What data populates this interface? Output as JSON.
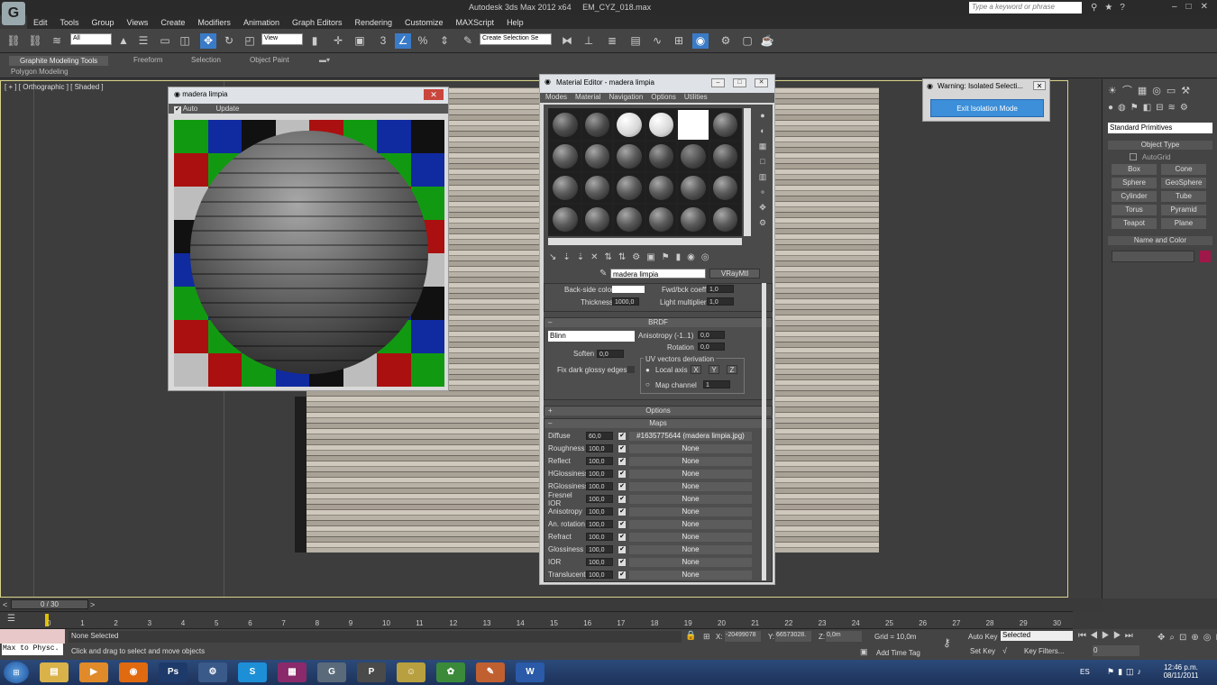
{
  "app": {
    "title_parts": [
      "Autodesk 3ds Max  2012 x64",
      "EM_CYZ_018.max"
    ],
    "search_placeholder": "Type a keyword or phrase"
  },
  "menu": [
    "Edit",
    "Tools",
    "Group",
    "Views",
    "Create",
    "Modifiers",
    "Animation",
    "Graph Editors",
    "Rendering",
    "Customize",
    "MAXScript",
    "Help"
  ],
  "toolbar": {
    "filter_all": "All",
    "ref_coord": "View",
    "selection_set": "Create Selection Se"
  },
  "ribbon": {
    "tabs": [
      "Graphite Modeling Tools",
      "Freeform",
      "Selection",
      "Object Paint"
    ],
    "sub": "Polygon Modeling"
  },
  "viewport": {
    "label": "[ + ] [ Orthographic ] [ Shaded ]"
  },
  "preview": {
    "title": "madera limpia",
    "auto": "Auto",
    "update": "Update"
  },
  "material_editor": {
    "title": "Material Editor - madera limpia",
    "menu": [
      "Modes",
      "Material",
      "Navigation",
      "Options",
      "Utilities"
    ],
    "material_name": "madera limpia",
    "material_type": "VRayMtl",
    "refraction": {
      "back_side_color": "Back-side color",
      "fwd_bck_coeff": "Fwd/bck coeff",
      "fwd_bck_value": "1,0",
      "thickness": "Thickness",
      "thickness_value": "1000,0",
      "light_multiplier": "Light multiplier",
      "light_value": "1,0"
    },
    "brdf": {
      "header": "BRDF",
      "type": "Blinn",
      "anisotropy": "Anisotropy (-1..1)",
      "anisotropy_value": "0,0",
      "rotation": "Rotation",
      "rotation_value": "0,0",
      "soften": "Soften",
      "soften_value": "0,0",
      "fix_dark": "Fix dark glossy edges",
      "uv_group": "UV vectors derivation",
      "local_axis": "Local axis",
      "axis_x": "X",
      "axis_y": "Y",
      "axis_z": "Z",
      "map_channel": "Map channel",
      "map_channel_value": "1"
    },
    "options_header": "Options",
    "maps_header": "Maps",
    "maps": [
      {
        "name": "Diffuse",
        "amount": "60,0",
        "map": "#1635775644 (madera limpia.jpg)"
      },
      {
        "name": "Roughness",
        "amount": "100,0",
        "map": "None"
      },
      {
        "name": "Reflect",
        "amount": "100,0",
        "map": "None"
      },
      {
        "name": "HGlossiness",
        "amount": "100,0",
        "map": "None"
      },
      {
        "name": "RGlossiness",
        "amount": "100,0",
        "map": "None"
      },
      {
        "name": "Fresnel IOR",
        "amount": "100,0",
        "map": "None"
      },
      {
        "name": "Anisotropy",
        "amount": "100,0",
        "map": "None"
      },
      {
        "name": "An. rotation",
        "amount": "100,0",
        "map": "None"
      },
      {
        "name": "Refract",
        "amount": "100,0",
        "map": "None"
      },
      {
        "name": "Glossiness",
        "amount": "100,0",
        "map": "None"
      },
      {
        "name": "IOR",
        "amount": "100,0",
        "map": "None"
      },
      {
        "name": "Translucent",
        "amount": "100,0",
        "map": "None"
      }
    ]
  },
  "warning": {
    "title": "Warning: Isolated Selecti...",
    "button": "Exit Isolation Mode"
  },
  "command_panel": {
    "dropdown": "Standard Primitives",
    "object_type": "Object Type",
    "autogrid": "AutoGrid",
    "primitives": [
      "Box",
      "Cone",
      "Sphere",
      "GeoSphere",
      "Cylinder",
      "Tube",
      "Torus",
      "Pyramid",
      "Teapot",
      "Plane"
    ],
    "name_color": "Name and Color"
  },
  "timeline": {
    "frame": "0 / 30",
    "ticks": [
      "0",
      "1",
      "2",
      "3",
      "4",
      "5",
      "6",
      "7",
      "8",
      "9",
      "10",
      "11",
      "12",
      "13",
      "14",
      "15",
      "16",
      "17",
      "18",
      "19",
      "20",
      "21",
      "22",
      "23",
      "24",
      "25",
      "26",
      "27",
      "28",
      "29",
      "30"
    ]
  },
  "status": {
    "script": "Max to Physc.",
    "selected": "None Selected",
    "prompt": "Click and drag to select and move objects",
    "x_label": "X:",
    "x": "-20499078",
    "y_label": "Y:",
    "y": "66573028.",
    "z_label": "Z:",
    "z": "0,0m",
    "grid": "Grid = 10,0m",
    "add_time_tag": "Add Time Tag",
    "auto_key": "Auto Key",
    "set_key": "Set Key",
    "key_mode": "Selected",
    "key_filters": "Key Filters...",
    "frame_field": "0"
  },
  "taskbar": {
    "lang": "ES",
    "time": "12:46 p.m.",
    "date": "08/11/2011"
  }
}
